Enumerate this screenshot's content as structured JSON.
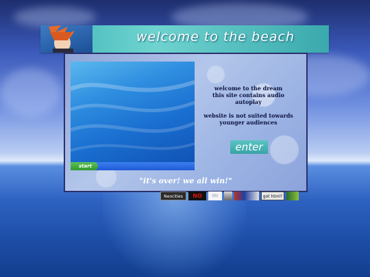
{
  "header": {
    "title": "welcome to the beach"
  },
  "main": {
    "info_lines": [
      "welcome to the dream",
      "this site contains audio autoplay",
      "",
      "website is not suited towards",
      "younger audiences"
    ],
    "enter_label": "enter",
    "quote": "\"it's over! we all win!\""
  },
  "desktop": {
    "start_label": "start"
  },
  "badges": [
    {
      "name": "neocities-badge",
      "label": "Neocities"
    },
    {
      "name": "no-badge",
      "label": "NO"
    },
    {
      "name": "wii-badge",
      "label": "Wii"
    },
    {
      "name": "person-badge",
      "label": ""
    },
    {
      "name": "game-badge",
      "label": ""
    },
    {
      "name": "got-html-badge",
      "label": "got html?"
    },
    {
      "name": "character-badge",
      "label": ""
    }
  ],
  "colors": {
    "header_bar": "#4fc2c2",
    "panel_border": "#2a2f6c",
    "text_dark": "#0d1240"
  }
}
